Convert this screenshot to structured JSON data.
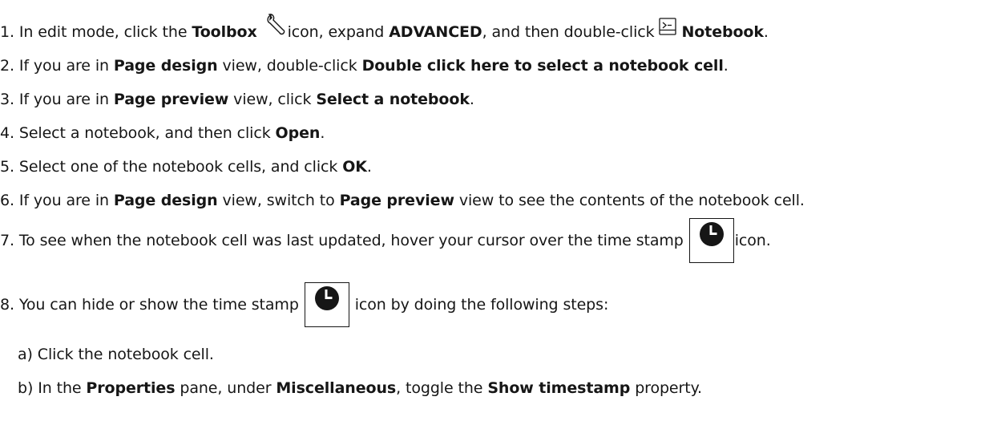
{
  "steps": {
    "s1": {
      "pre": "1. In edit mode, click the ",
      "toolbox": "Toolbox",
      "mid": "icon, expand ",
      "advanced": "ADVANCED",
      "mid2": ", and then double-click ",
      "notebook": "Notebook",
      "end": "."
    },
    "s2": {
      "pre": "2. If you are in ",
      "page_design": "Page design",
      "mid": " view, double-click ",
      "target": "Double click here to select a notebook cell",
      "end": "."
    },
    "s3": {
      "pre": "3. If you are in ",
      "page_preview": "Page preview",
      "mid": " view, click ",
      "target": "Select a notebook",
      "end": "."
    },
    "s4": {
      "pre": "4. Select a notebook, and then click ",
      "open": "Open",
      "end": "."
    },
    "s5": {
      "pre": "5. Select one of the notebook cells, and click ",
      "ok": "OK",
      "end": "."
    },
    "s6": {
      "pre": "6. If you are in ",
      "page_design": "Page design",
      "mid": " view, switch to ",
      "page_preview": "Page preview",
      "end": " view to see the contents of the notebook cell."
    },
    "s7": {
      "pre": "7. To see when the notebook cell was last updated, hover your cursor over the time stamp ",
      "end": "icon."
    },
    "s8": {
      "pre": "8. You can hide or show the time stamp ",
      "end": " icon by doing the following steps:"
    },
    "s8a": {
      "text": "a) Click the notebook cell."
    },
    "s8b": {
      "pre": "b) In the ",
      "properties": "Properties",
      "mid": " pane, under ",
      "misc": "Miscellaneous",
      "mid2": ", toggle the ",
      "show_ts": "Show timestamp",
      "end": " property."
    }
  },
  "icons": [
    "wrench-icon",
    "notebook-icon",
    "timestamp-icon"
  ]
}
